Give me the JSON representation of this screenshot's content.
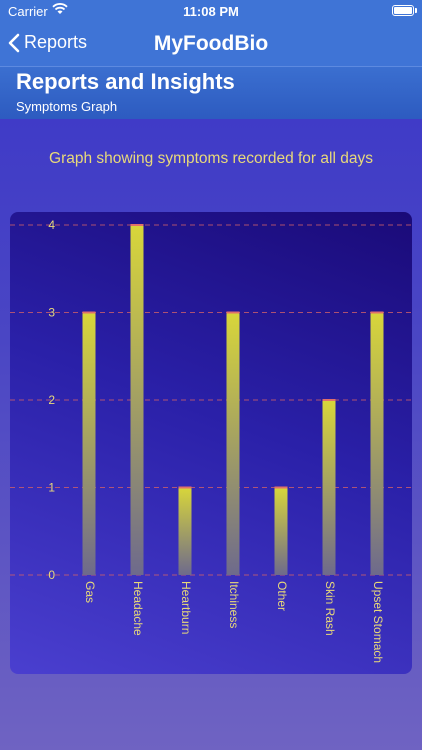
{
  "status_bar": {
    "carrier": "Carrier",
    "time": "11:08 PM"
  },
  "nav": {
    "back_label": "Reports",
    "title": "MyFoodBio"
  },
  "header": {
    "title": "Reports and Insights",
    "subtitle": "Symptoms Graph"
  },
  "caption": "Graph showing symptoms recorded for all days",
  "colors": {
    "bar_top": "#d8d63a",
    "bar_bottom": "#6e6a8c",
    "bar_cap": "#e0706a",
    "gridline": "#d0606a",
    "tick_text": "#e8d97a"
  },
  "chart_data": {
    "type": "bar",
    "categories": [
      "Gas",
      "Headache",
      "Heartburn",
      "Itchiness",
      "Other",
      "Skin Rash",
      "Upset Stomach"
    ],
    "values": [
      3,
      4,
      1,
      3,
      1,
      2,
      3
    ],
    "y_ticks": [
      "0",
      "1",
      "2",
      "3",
      "4"
    ],
    "ylim": [
      0,
      4
    ],
    "grid": true
  }
}
